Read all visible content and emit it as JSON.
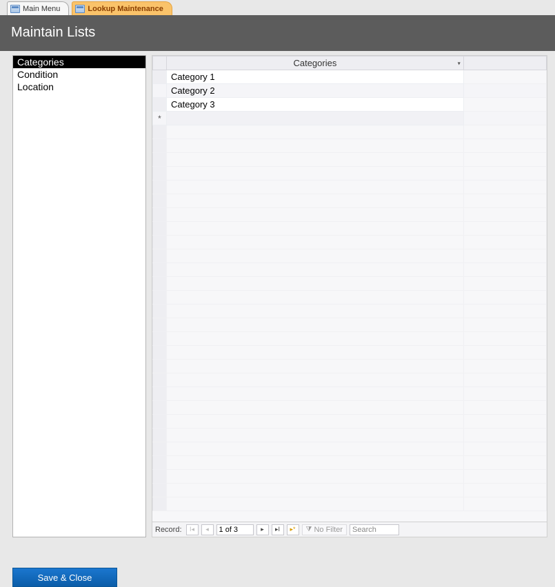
{
  "tabs": [
    {
      "label": "Main Menu",
      "active": false
    },
    {
      "label": "Lookup Maintenance",
      "active": true
    }
  ],
  "header": {
    "title": "Maintain Lists"
  },
  "sidebar": {
    "items": [
      {
        "label": "Categories",
        "selected": true
      },
      {
        "label": "Condition",
        "selected": false
      },
      {
        "label": "Location",
        "selected": false
      }
    ]
  },
  "grid": {
    "column_header": "Categories",
    "rows": [
      {
        "value": "Category 1"
      },
      {
        "value": "Category 2"
      },
      {
        "value": "Category 3"
      }
    ],
    "new_row_marker": "*",
    "blank_row_count": 28
  },
  "record_nav": {
    "label": "Record:",
    "position": "1 of 3",
    "filter_label": "No Filter",
    "search_placeholder": "Search"
  },
  "footer": {
    "save_label": "Save & Close"
  }
}
